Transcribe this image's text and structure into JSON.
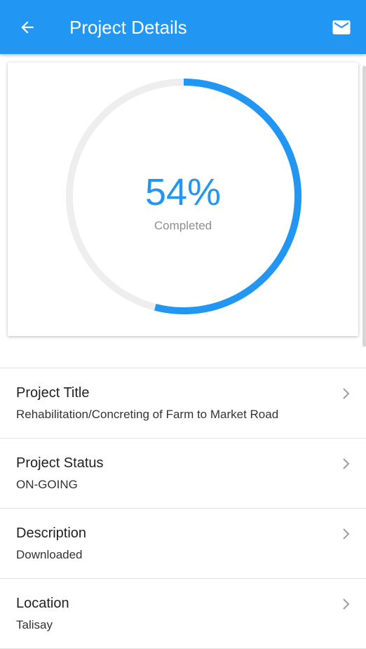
{
  "header": {
    "title": "Project Details",
    "back_icon": "arrow-back-icon",
    "mail_icon": "mail-icon",
    "color": "#2196f3"
  },
  "progress": {
    "value_text": "54%",
    "fraction": 0.54,
    "label": "Completed",
    "accent_color": "#2196f3",
    "track_color": "#eeeeee"
  },
  "details": [
    {
      "label": "Project Title",
      "value": "Rehabilitation/Concreting of Farm to Market Road"
    },
    {
      "label": "Project Status",
      "value": "ON-GOING"
    },
    {
      "label": "Description",
      "value": "Downloaded"
    },
    {
      "label": "Location",
      "value": "Talisay"
    }
  ]
}
